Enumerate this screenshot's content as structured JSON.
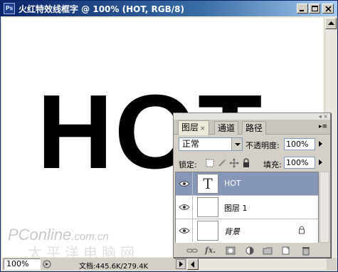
{
  "window": {
    "title": "火红特效线框字 @ 100% (HOT, RGB/8)",
    "app_icon": "Ps"
  },
  "canvas": {
    "text": "HOT"
  },
  "watermark": {
    "brand": "PConline",
    "domain": ".com.cn",
    "subtitle": "太平洋电脑网"
  },
  "status": {
    "zoom": "100%",
    "doc_info": "文档:445.6K/279.4K"
  },
  "layers_panel": {
    "tabs": [
      {
        "label": "图层",
        "active": true
      },
      {
        "label": "通道",
        "active": false
      },
      {
        "label": "路径",
        "active": false
      }
    ],
    "blend_mode": "正常",
    "opacity_label": "不透明度:",
    "opacity_value": "100%",
    "lock_label": "锁定:",
    "fill_label": "填充:",
    "fill_value": "100%",
    "layers": [
      {
        "name": "HOT",
        "thumb": "T",
        "selected": true,
        "visible": true
      },
      {
        "name": "图层 1",
        "thumb": "",
        "selected": false,
        "visible": true
      },
      {
        "name": "背景",
        "thumb": "",
        "selected": false,
        "visible": true,
        "locked": true
      }
    ],
    "bottom_icons": [
      "link-icon",
      "fx-icon",
      "mask-icon",
      "adjustment-icon",
      "group-icon",
      "new-layer-icon",
      "trash-icon"
    ],
    "fx_label": "fx."
  },
  "colors": {
    "titlebar_start": "#0a246a",
    "titlebar_end": "#a6caf0",
    "selected_layer": "#8596b8",
    "chrome": "#d4d0c8"
  }
}
